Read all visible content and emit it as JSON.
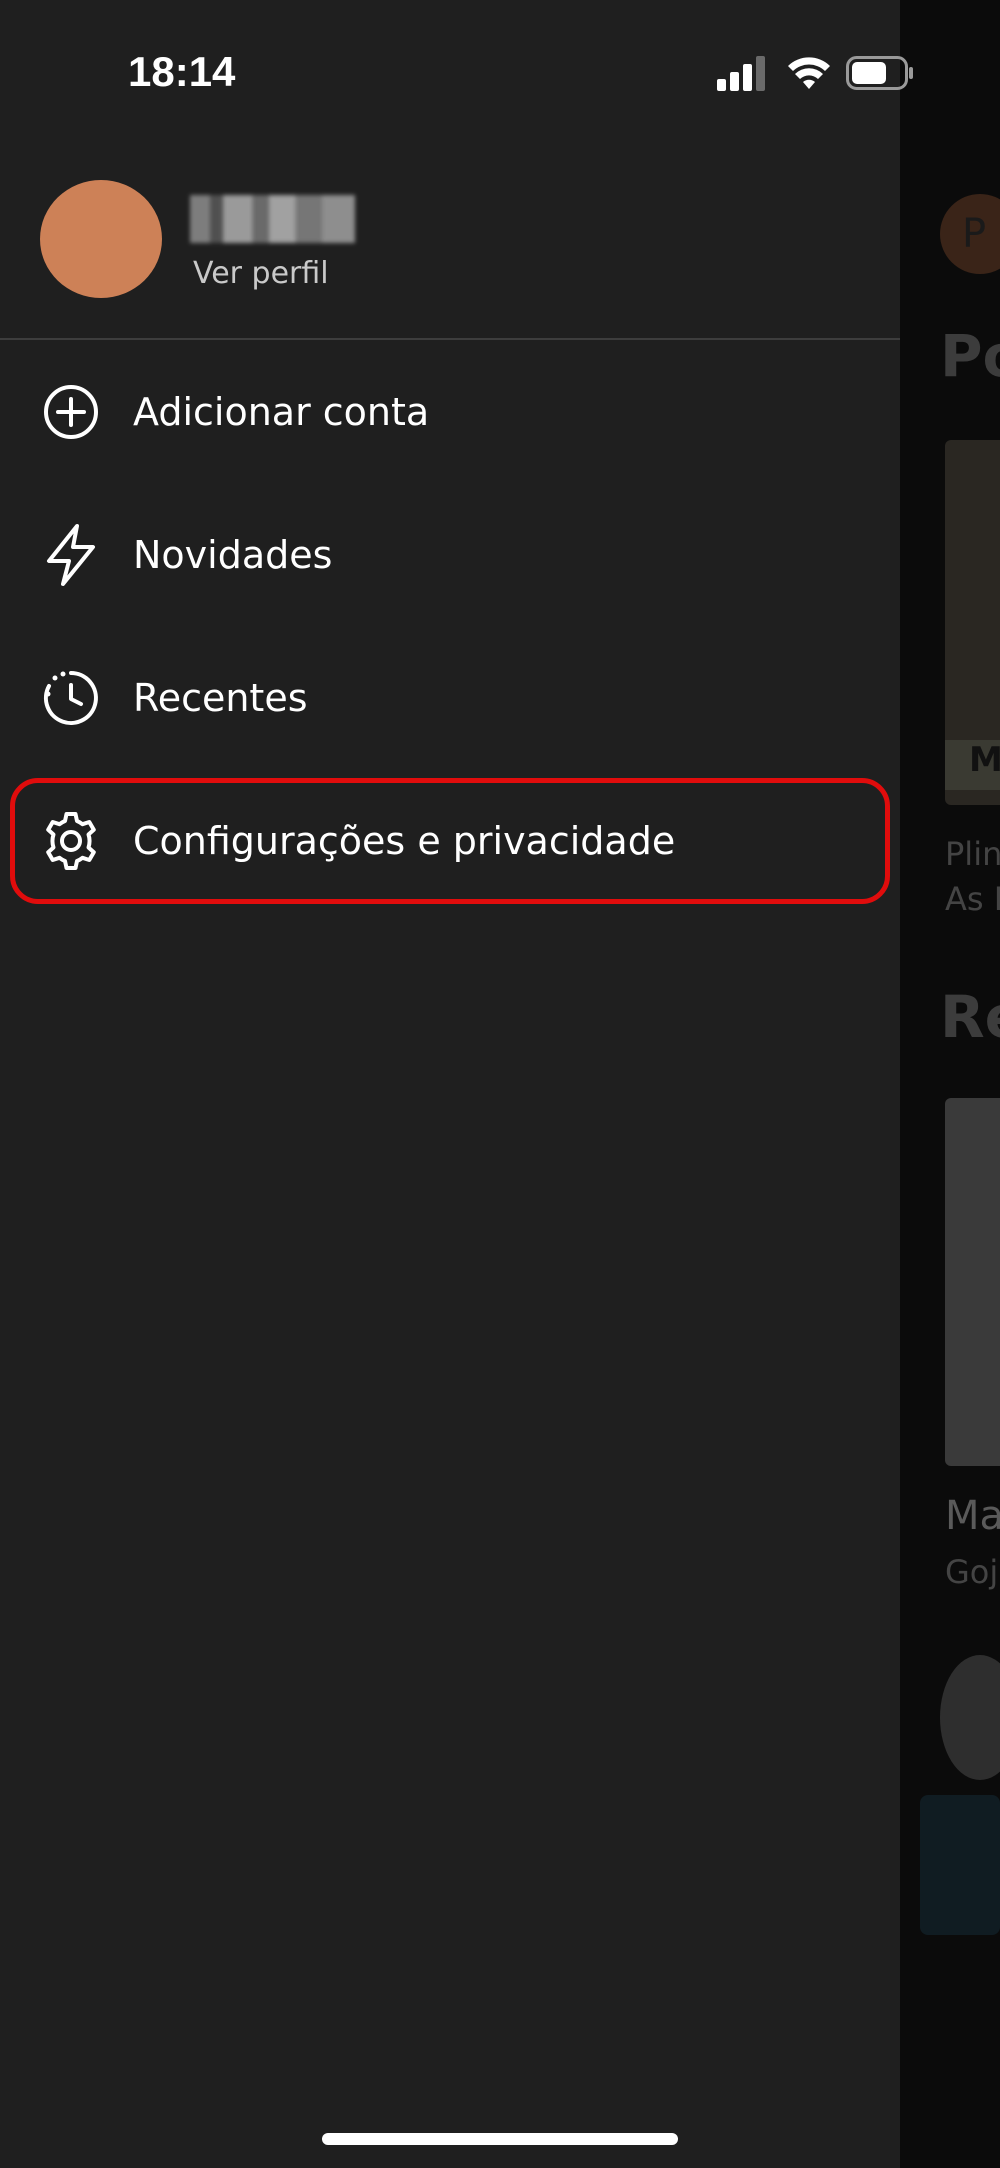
{
  "status_bar": {
    "time": "18:14"
  },
  "profile": {
    "view_profile_label": "Ver perfil"
  },
  "menu": [
    {
      "label": "Adicionar conta",
      "icon": "plus-circle-icon"
    },
    {
      "label": "Novidades",
      "icon": "lightning-icon"
    },
    {
      "label": "Recentes",
      "icon": "recent-clock-icon"
    },
    {
      "label": "Configurações e privacidade",
      "icon": "gear-icon"
    }
  ],
  "background_screen": {
    "avatar_letter": "P",
    "heading_1": "Po",
    "caption_1": "Plin",
    "caption_2": "As L",
    "heading_2": "Re",
    "title_3": "Ma",
    "caption_3": "Goj",
    "badge_letter": "M"
  },
  "colors": {
    "drawer_bg": "#1f1f1f",
    "avatar": "#cd8157",
    "highlight": "#e00c0c"
  }
}
